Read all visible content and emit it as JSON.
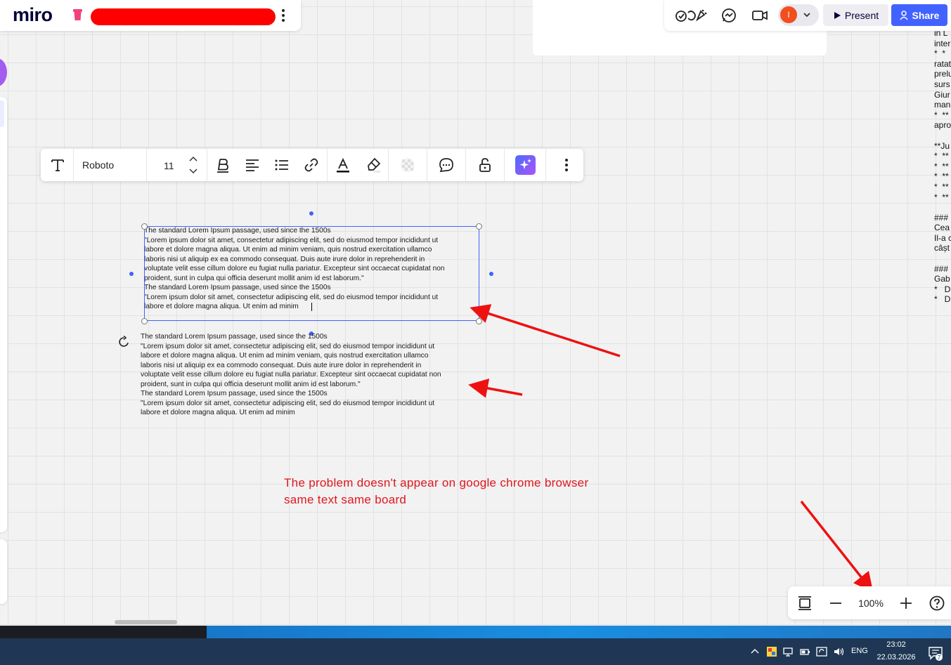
{
  "app": {
    "logo": "miro"
  },
  "header": {
    "present_label": "Present",
    "share_label": "Share",
    "avatar_initial": "I"
  },
  "toolbar": {
    "font_name": "Roboto",
    "font_size": "11"
  },
  "board": {
    "text_top": "The standard Lorem Ipsum passage, used since the 1500s\n\"Lorem ipsum dolor sit amet, consectetur adipiscing elit, sed do eiusmod tempor incididunt ut\nlabore et dolore magna aliqua. Ut enim ad minim veniam, quis nostrud exercitation ullamco\nlaboris nisi ut aliquip ex ea commodo consequat. Duis aute irure dolor in reprehenderit in\nvoluptate velit esse cillum dolore eu fugiat nulla pariatur. Excepteur sint occaecat cupidatat non\nproident, sunt in culpa qui officia deserunt mollit anim id est laborum.\"\nThe standard Lorem Ipsum passage, used since the 1500s\n\"Lorem ipsum dolor sit amet, consectetur adipiscing elit, sed do eiusmod tempor incididunt ut\nlabore et dolore magna aliqua. Ut enim ad minim",
    "text_bottom": "The standard Lorem Ipsum passage, used since the 1500s\n\"Lorem ipsum dolor sit amet, consectetur adipiscing elit, sed do eiusmod tempor incididunt ut\nlabore et dolore magna aliqua. Ut enim ad minim veniam, quis nostrud exercitation ullamco\nlaboris nisi ut aliquip ex ea commodo consequat. Duis aute irure dolor in reprehenderit in\nvoluptate velit esse cillum dolore eu fugiat nulla pariatur. Excepteur sint occaecat cupidatat non\nproident, sunt in culpa qui officia deserunt mollit anim id est laborum.\"\nThe standard Lorem Ipsum passage, used since the 1500s\n\"Lorem ipsum dolor sit amet, consectetur adipiscing elit, sed do eiusmod tempor incididunt ut\nlabore et dolore magna aliqua. Ut enim ad minim",
    "annotation": "The problem doesn't appear on google chrome browser\nsame text same board",
    "side_text": "in L\ninter\n*  *\nratat\nprelu\nsurs\nGiur\nman\n*  **\naproa\n\n**Ju\n*  **\n*  **\n*  **\n*  **\n*  **\n\n###\nCea\nIl-a c\ncâșt\n\n###\nGab\n*   D\n*   D"
  },
  "zoom": {
    "level": "100%"
  },
  "taskbar": {
    "language": "ENG",
    "time": "23:02",
    "date": "22.03.2026",
    "notification_count": "7"
  },
  "colors": {
    "accent": "#4262ff",
    "annotation": "#e0161d",
    "board_name_redaction": "#ff0000",
    "avatar": "#f24e1e"
  }
}
